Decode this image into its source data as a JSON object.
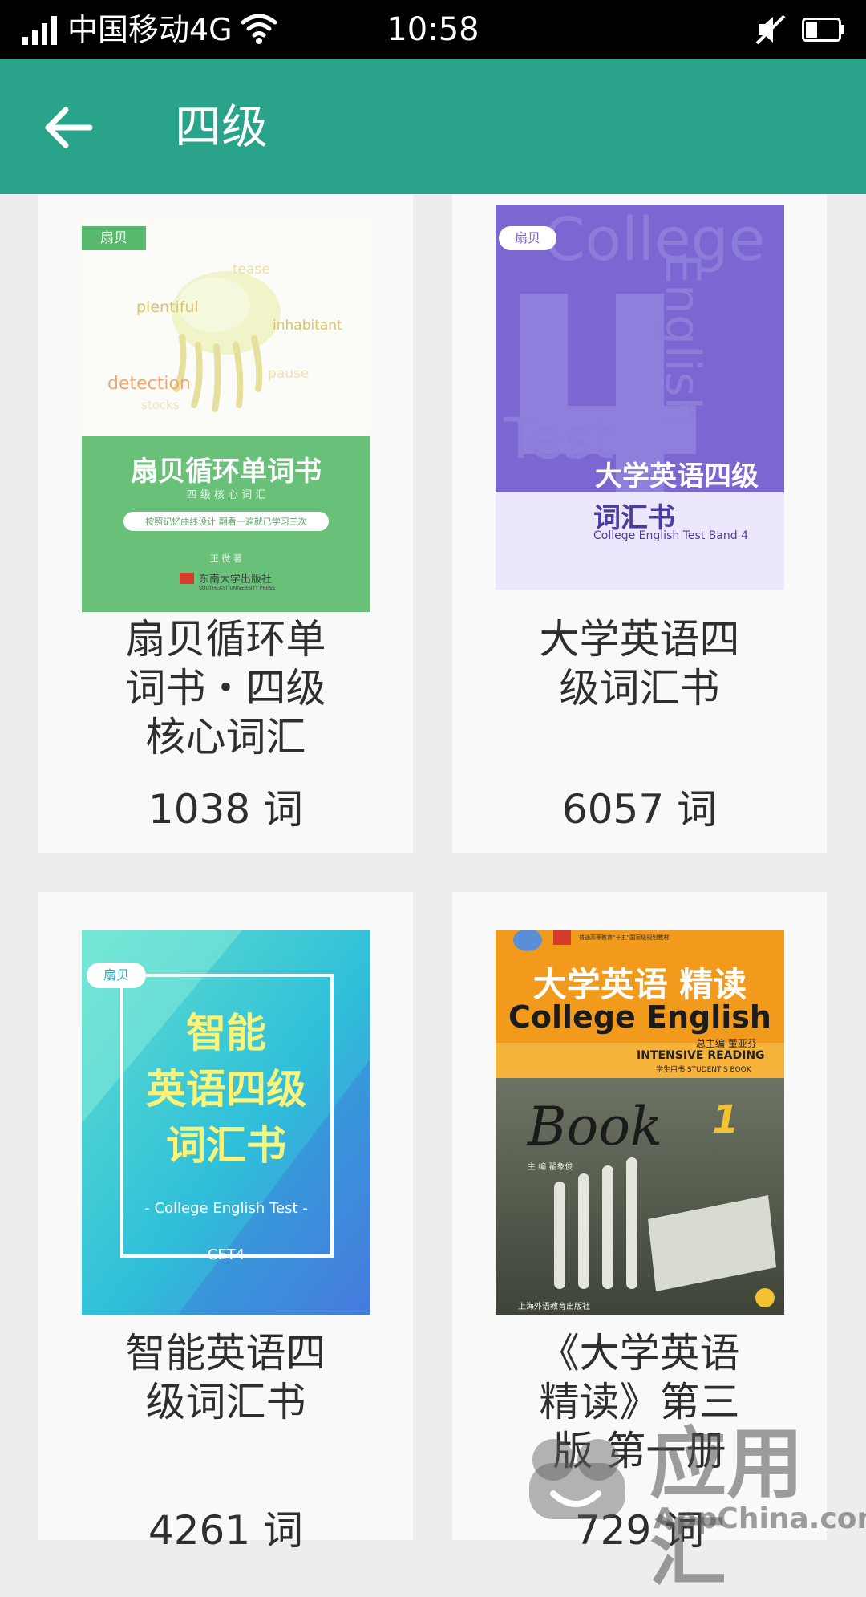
{
  "status_bar": {
    "carrier": "中国移动4G",
    "time": "10:58"
  },
  "app_bar": {
    "title": "四级"
  },
  "books": [
    {
      "title_lines": [
        "扇贝循环单",
        "词书・四级",
        "核心词汇"
      ],
      "count": "1038 词",
      "cover": {
        "brand": "扇贝",
        "words": [
          "tease",
          "plentiful",
          "inhabitant",
          "detection",
          "pause",
          "stocks"
        ],
        "title": "扇贝循环单词书",
        "subtitle": "四 级 核 心 词 汇",
        "features": "按照记忆曲线设计   翻看一遍就已学习三次",
        "author": "王 微  著",
        "publisher": "东南大学出版社",
        "publisher_en": "SOUTHEAST UNIVERSITY PRESS"
      }
    },
    {
      "title_lines": [
        "大学英语四",
        "级词汇书"
      ],
      "count": "6057 词",
      "cover": {
        "brand": "扇贝",
        "title_line1": "大学英语四级",
        "title_line2": "词汇书",
        "subtitle": "College English Test Band 4",
        "bg_text1": "College",
        "bg_text2": "English",
        "bg_text3": "Test",
        "bg_number": "4"
      }
    },
    {
      "title_lines": [
        "智能英语四",
        "级词汇书"
      ],
      "count": "4261 词",
      "cover": {
        "brand": "扇贝",
        "line1": "智能",
        "line2": "英语四级",
        "line3": "词汇书",
        "subtitle": "- College English Test -",
        "tag": "CET4"
      }
    },
    {
      "title_lines": [
        "《大学英语",
        "精读》第三",
        "版 第一册"
      ],
      "count": "729 词",
      "cover": {
        "title_cn": "大学英语 精读",
        "title_en": "College English",
        "chief_editor": "总主编  董亚芬",
        "series": "INTENSIVE READING",
        "edition_label": "学生用书  STUDENT'S BOOK",
        "book_text": "Book",
        "book_number": "1",
        "editor": "主 编  翟象俊",
        "publisher": "上海外语教育出版社",
        "top_note": "普通高等教育“十五”国家级规划教材"
      }
    }
  ],
  "watermark": {
    "text": "应用汇",
    "domain": "AppChina.com"
  },
  "colors": {
    "status_bar": "#000000",
    "app_bar": "#29a38a",
    "background": "#ededed",
    "card": "#f9f9f9"
  }
}
